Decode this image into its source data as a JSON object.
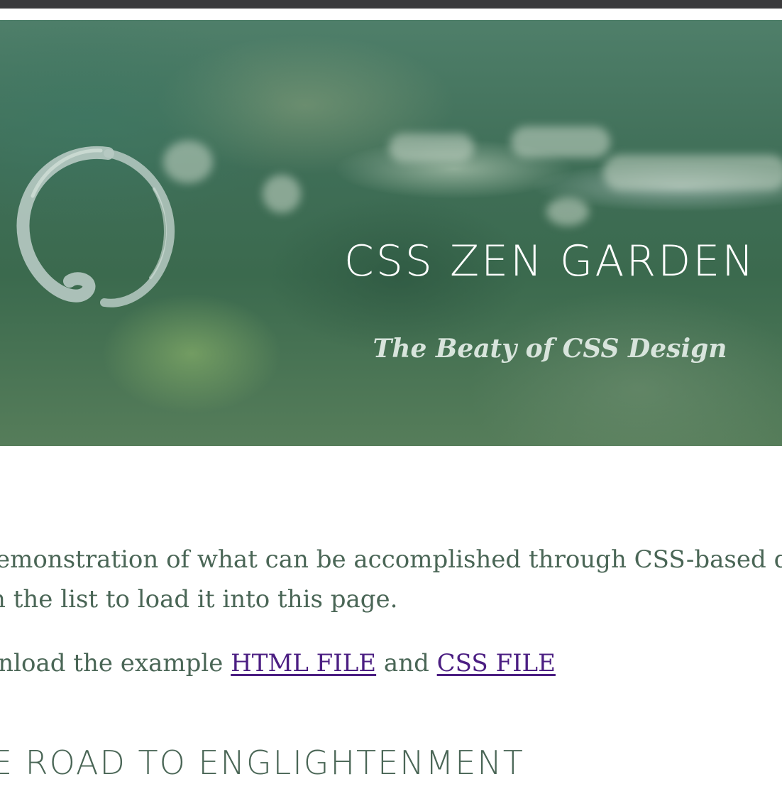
{
  "header": {
    "title": "CSS ZEN GARDEN",
    "tagline": "The Beaty of CSS Design",
    "logo_icon": "enso-circle-icon"
  },
  "intro": {
    "line1": "emonstration of what can be accomplished through CSS-based d",
    "line2": "n the list to load it into this page.",
    "download_prefix": "vnload the example ",
    "html_file_link": "HTML FILE",
    "conjunction": " and ",
    "css_file_link": "CSS FILE"
  },
  "section": {
    "heading": "E ROAD TO ENGLIGHTENMENT"
  },
  "colors": {
    "text": "#4a6656",
    "link": "#4b1e82",
    "title": "#ffffff",
    "tagline": "#d8e4dc"
  }
}
